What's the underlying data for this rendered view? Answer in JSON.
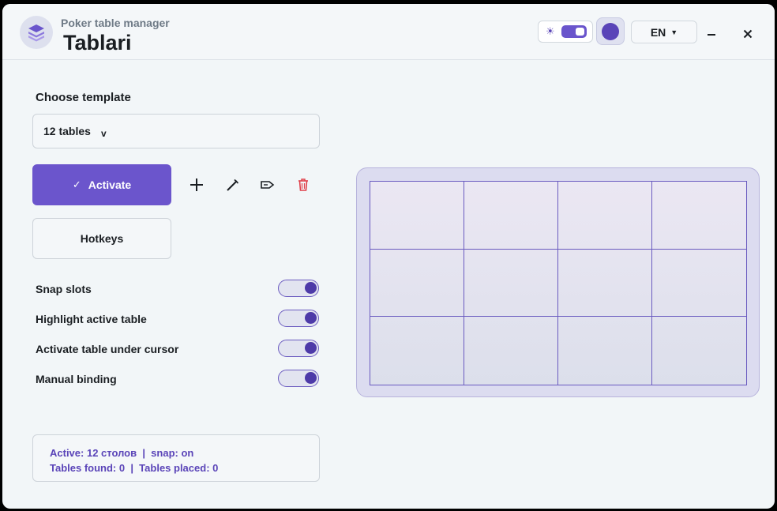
{
  "header": {
    "subtitle": "Poker table manager",
    "title": "Tablari",
    "theme_icon": "sun-icon",
    "language": "EN",
    "minimize_label": "–",
    "close_label": "×"
  },
  "template": {
    "label": "Choose template",
    "selected": "12 tables"
  },
  "actions": {
    "activate_label": "Activate",
    "hotkeys_label": "Hotkeys",
    "icons": [
      "plus-icon",
      "pencil-icon",
      "tag-icon",
      "trash-icon"
    ]
  },
  "toggles": [
    {
      "label": "Snap slots",
      "on": true
    },
    {
      "label": "Highlight active table",
      "on": true
    },
    {
      "label": "Activate table under cursor",
      "on": true
    },
    {
      "label": "Manual binding",
      "on": true
    }
  ],
  "status": {
    "line1": "Active: 12 столов  |  snap: on",
    "line2": "Tables found: 0  |  Tables placed: 0"
  },
  "preview": {
    "rows": 3,
    "cols": 4
  },
  "colors": {
    "accent": "#6b55cc",
    "accent_dark": "#5a44b8",
    "danger": "#e0404a",
    "background": "#f2f6f8"
  }
}
